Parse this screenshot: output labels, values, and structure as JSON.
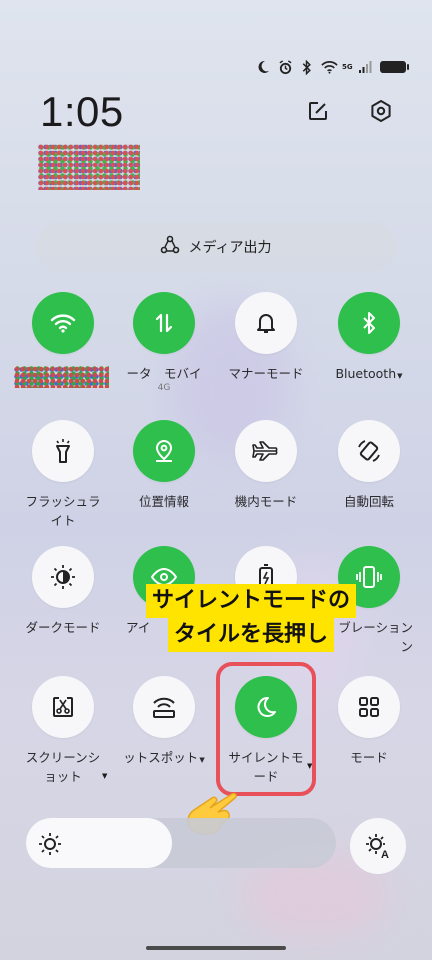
{
  "status_bar": {
    "network_type": "5G",
    "icons": [
      "moon-icon",
      "alarm-icon",
      "bluetooth-icon",
      "wifi-icon",
      "signal-icon",
      "battery-icon"
    ]
  },
  "clock": "1:05",
  "top_actions": [
    "edit-icon",
    "settings-icon"
  ],
  "media_output": {
    "label": "メディア出力"
  },
  "tiles": [
    {
      "id": "wifi",
      "label": "",
      "on": true
    },
    {
      "id": "mobile-data",
      "label": "ータ　モバイ",
      "sub": "4G",
      "on": true
    },
    {
      "id": "manner-mode",
      "label": "マナーモード",
      "on": false
    },
    {
      "id": "bluetooth",
      "label": "Bluetooth",
      "on": true
    },
    {
      "id": "flashlight",
      "label": "フラッシュラ\nイト",
      "on": false
    },
    {
      "id": "location",
      "label": "位置情報",
      "on": true
    },
    {
      "id": "airplane",
      "label": "機内モード",
      "on": false
    },
    {
      "id": "auto-rotate",
      "label": "自動回転",
      "on": false
    },
    {
      "id": "dark-mode",
      "label": "ダークモード",
      "on": false
    },
    {
      "id": "eye-comfort",
      "label": "アイ",
      "on": true
    },
    {
      "id": "battery-saver",
      "label": "",
      "on": false
    },
    {
      "id": "vibration",
      "label": "ブレーション\nン",
      "on": true
    },
    {
      "id": "screenshot",
      "label": "スクリーンシ\nョット",
      "on": false
    },
    {
      "id": "hotspot",
      "label": "ットスポット",
      "on": false
    },
    {
      "id": "silent-mode",
      "label": "サイレントモ\nード",
      "on": true
    },
    {
      "id": "modes",
      "label": "モード",
      "on": false
    }
  ],
  "annotation": {
    "line1": "サイレントモードの",
    "line2": "タイルを長押し"
  },
  "brightness": {
    "level": 0.47
  },
  "colors": {
    "tile_on": "#2fbf4c",
    "tile_off": "#f7f7f9",
    "highlight": "#ffe400",
    "annotation_box": "#e8505a"
  }
}
